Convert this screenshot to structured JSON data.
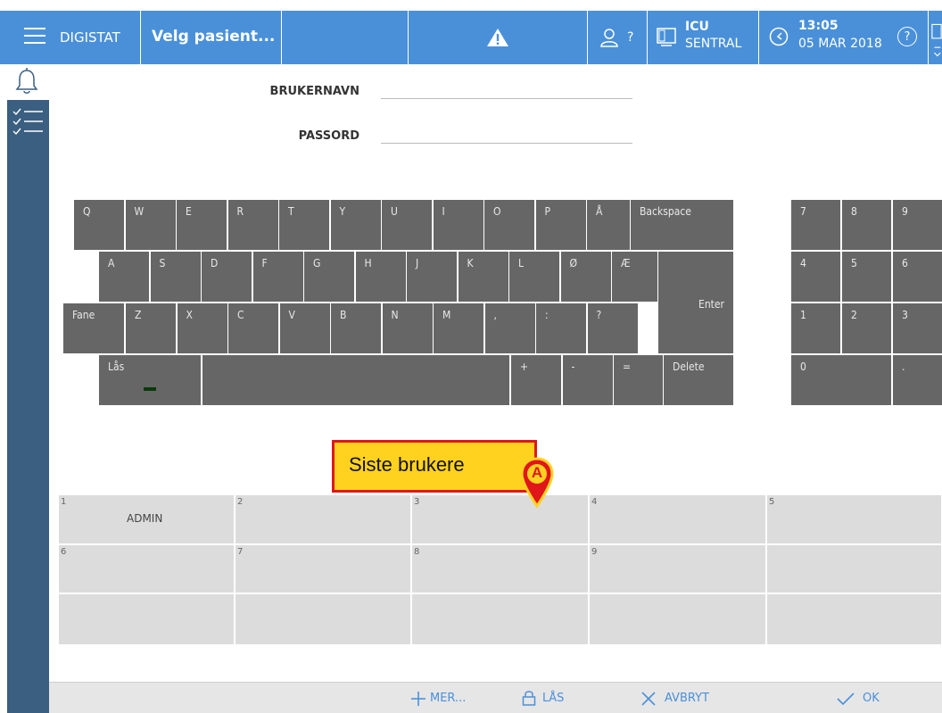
{
  "topbar": {
    "menu_label": "DIGISTAT",
    "patient_label": "Velg pasient...",
    "user_label": "?",
    "unit_title": "ICU",
    "unit_sub": "SENTRAL",
    "time": "13:05",
    "date": "05 MAR 2018",
    "help": "?"
  },
  "login": {
    "username_label": "BRUKERNAVN",
    "password_label": "PASSORD"
  },
  "keyboard": {
    "row1": [
      "Q",
      "W",
      "E",
      "R",
      "T",
      "Y",
      "U",
      "I",
      "O",
      "P",
      "Å",
      "Backspace"
    ],
    "row2": [
      "A",
      "S",
      "D",
      "F",
      "G",
      "H",
      "J",
      "K",
      "L",
      "Ø",
      "Æ"
    ],
    "enter": "Enter",
    "row3": [
      "Fane",
      "Z",
      "X",
      "C",
      "V",
      "B",
      "N",
      "M",
      ",",
      ":",
      "?"
    ],
    "row4": [
      "Lås",
      "+",
      "-",
      "=",
      "Delete"
    ],
    "numpad": [
      "7",
      "8",
      "9",
      "4",
      "5",
      "6",
      "1",
      "2",
      "3",
      "0",
      "."
    ]
  },
  "recent_users": {
    "cells": [
      {
        "num": "1",
        "user": "ADMIN"
      },
      {
        "num": "2",
        "user": ""
      },
      {
        "num": "3",
        "user": ""
      },
      {
        "num": "4",
        "user": ""
      },
      {
        "num": "5",
        "user": ""
      },
      {
        "num": "6",
        "user": ""
      },
      {
        "num": "7",
        "user": ""
      },
      {
        "num": "8",
        "user": ""
      },
      {
        "num": "9",
        "user": ""
      }
    ]
  },
  "callout": {
    "text": "Siste brukere",
    "marker": "A"
  },
  "bottombar": {
    "more": "MER...",
    "lock": "LÅS",
    "cancel": "AVBRYT",
    "ok": "OK"
  },
  "colors": {
    "accent": "#4a90d9",
    "sidebar": "#3a5f80",
    "key": "#666666",
    "callout_fill": "#ffd21f",
    "callout_border": "#e0161b"
  }
}
